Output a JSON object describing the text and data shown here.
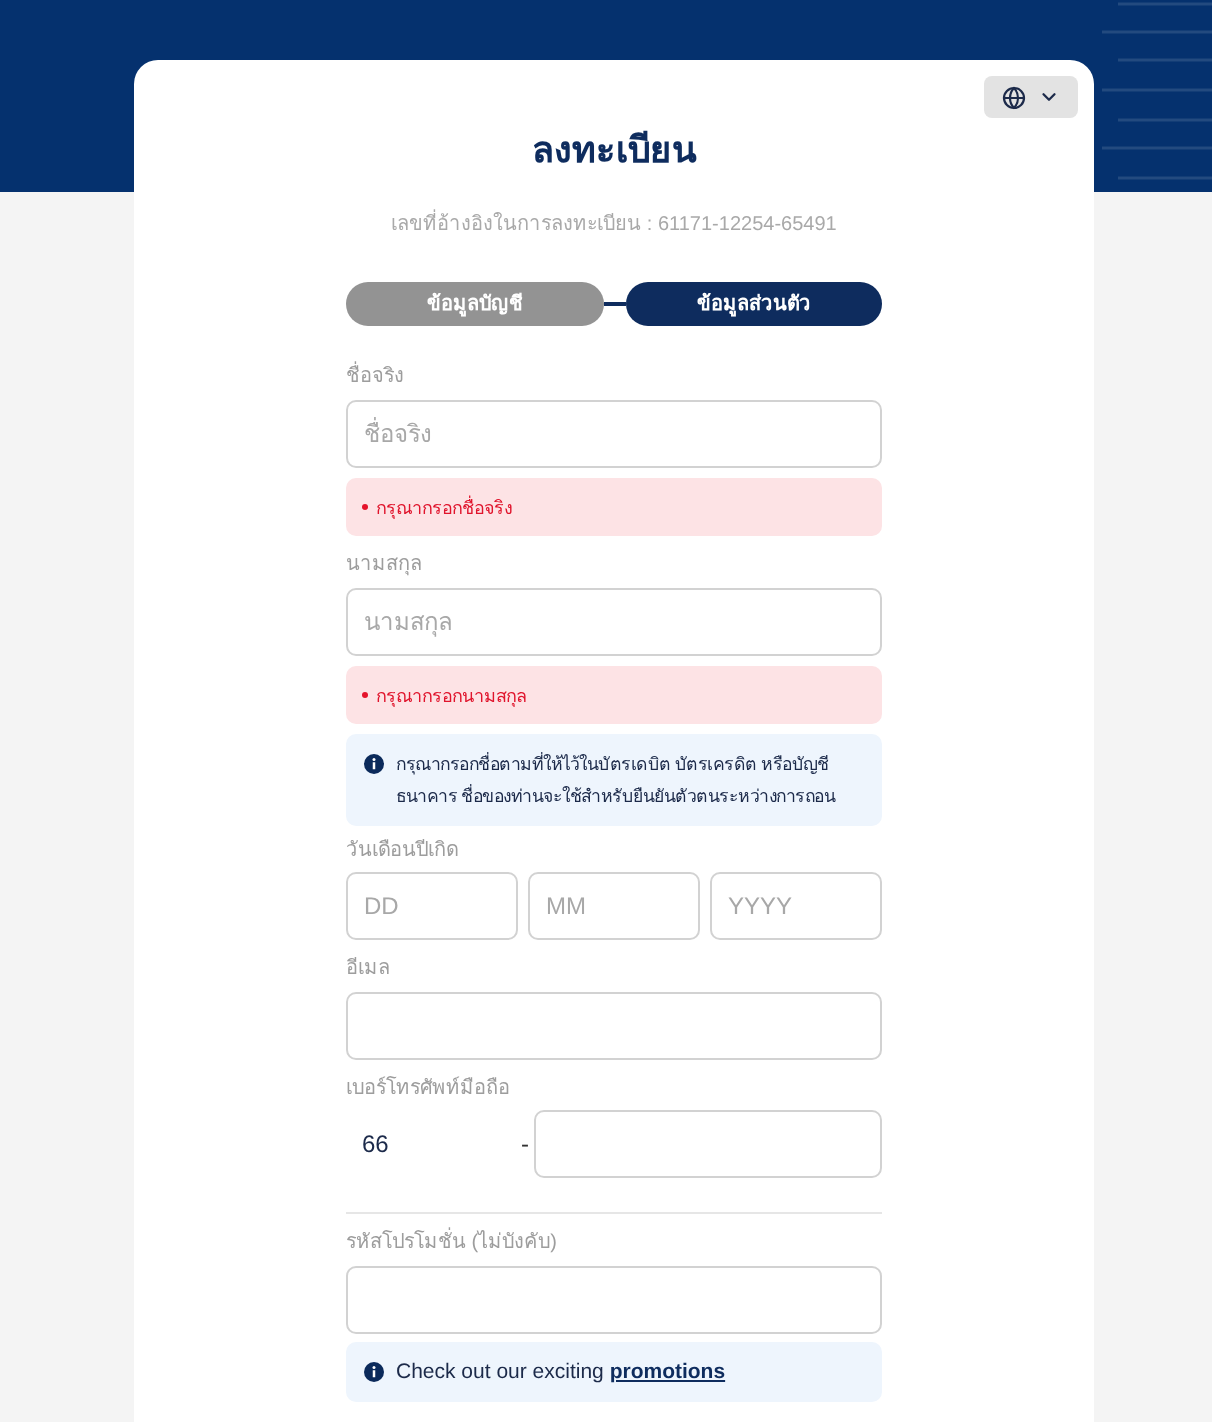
{
  "title": "ลงทะเบียน",
  "reference": "เลขที่อ้างอิงในการลงทะเบียน : 61171-12254-65491",
  "steps": [
    {
      "label": "ข้อมูลบัญชี",
      "selected": false
    },
    {
      "label": "ข้อมูลส่วนตัว",
      "selected": true
    }
  ],
  "form": [
    {
      "kind": "text",
      "label": "ชื่อจริง",
      "placeholder": "ชื่อจริง",
      "error": "กรุณากรอกชื่อจริง"
    },
    {
      "kind": "text",
      "label": "นามสกุล",
      "placeholder": "นามสกุล",
      "error": "กรุณากรอกนามสกุล"
    },
    {
      "kind": "info",
      "text": "กรุณากรอกชื่อตามที่ให้ไว้ในบัตรเดบิต บัตรเครดิต หรือบัญชีธนาคาร ชื่อของท่านจะใช้สำหรับยืนยันตัวตนระหว่างการถอน"
    },
    {
      "kind": "date",
      "label": "วันเดือนปีเกิด",
      "parts": [
        {
          "placeholder": "DD"
        },
        {
          "placeholder": "MM"
        },
        {
          "placeholder": "YYYY"
        }
      ]
    },
    {
      "kind": "text",
      "label": "อีเมล"
    },
    {
      "kind": "phone",
      "label": "เบอร์โทรศัพท์มือถือ",
      "country_code": "66",
      "separator": "-"
    },
    {
      "kind": "divider"
    },
    {
      "kind": "text",
      "label": "รหัสโปรโมชั่น (ไม่บังคับ)"
    },
    {
      "kind": "info",
      "text": "Check out our exciting ",
      "link": "promotions"
    }
  ]
}
